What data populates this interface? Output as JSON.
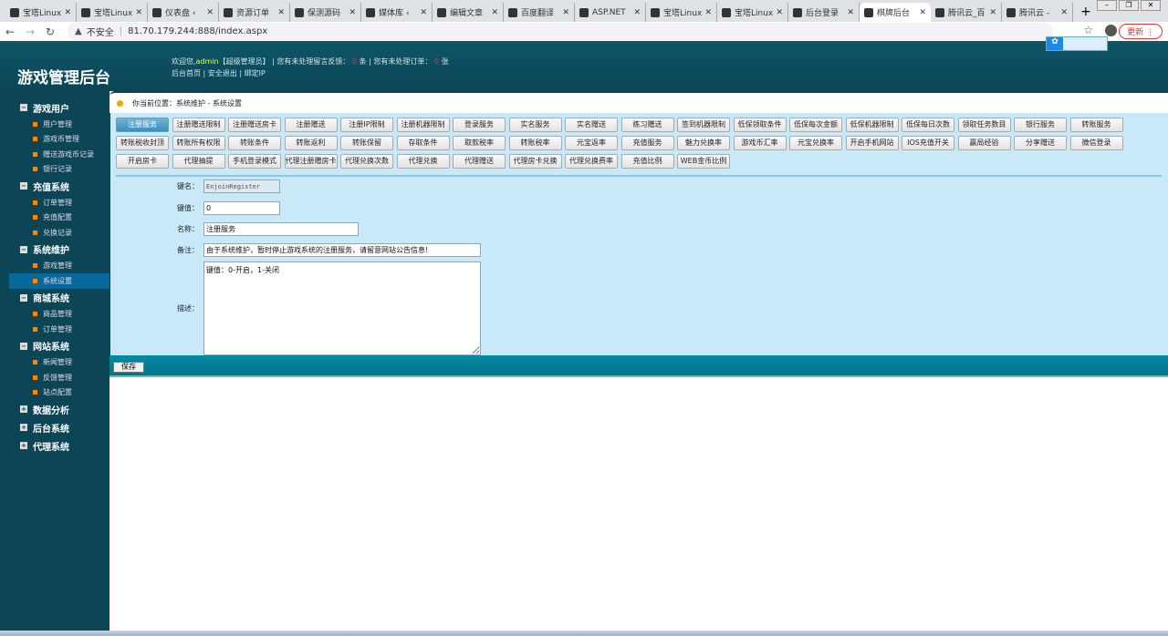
{
  "browser": {
    "tabs": [
      {
        "label": "宝塔Linux",
        "icon": "BT"
      },
      {
        "label": "宝塔Linux",
        "icon": "BT"
      },
      {
        "label": "仪表盘 ‹",
        "icon": "W"
      },
      {
        "label": "资源订单",
        "icon": "W"
      },
      {
        "label": "保测源码",
        "icon": "W"
      },
      {
        "label": "媒体库 ‹",
        "icon": "globe"
      },
      {
        "label": "编辑文章",
        "icon": "globe"
      },
      {
        "label": "百度翻译",
        "icon": "译"
      },
      {
        "label": "ASP.NET",
        "icon": "asp"
      },
      {
        "label": "宝塔Linux",
        "icon": "BT"
      },
      {
        "label": "宝塔Linux",
        "icon": "BT"
      },
      {
        "label": "后台登录",
        "icon": "globe"
      },
      {
        "label": "棋牌后台",
        "icon": "game",
        "active": true
      },
      {
        "label": "腾讯云_百",
        "icon": "paw"
      },
      {
        "label": "腾讯云 -",
        "icon": "cloud"
      }
    ],
    "insecure": "不安全",
    "url": "81.70.179.244:888/index.aspx",
    "update": "更新"
  },
  "header": {
    "title": "游戏管理后台",
    "welcome_prefix": "欢迎您,",
    "user": "admin",
    "role": "【超级管理员】",
    "feedback_prefix": "| 您有未处理留言反馈：",
    "feedback_count": "0",
    "feedback_unit": "条",
    "orders_prefix": "| 您有未处理订单：",
    "orders_count": "0",
    "orders_unit": "张",
    "links": [
      "后台首页",
      "安全退出",
      "绑定IP"
    ]
  },
  "sidebar": [
    {
      "label": "游戏用户",
      "expanded": true,
      "items": [
        "用户管理",
        "游戏币管理",
        "赠送游戏币记录",
        "银行记录"
      ]
    },
    {
      "label": "充值系统",
      "expanded": true,
      "items": [
        "订单管理",
        "充值配置",
        "兑换记录"
      ]
    },
    {
      "label": "系统维护",
      "expanded": true,
      "items": [
        "游戏管理",
        "系统设置"
      ],
      "selected": "系统设置"
    },
    {
      "label": "商城系统",
      "expanded": true,
      "items": [
        "商品管理",
        "订单管理"
      ]
    },
    {
      "label": "网站系统",
      "expanded": true,
      "items": [
        "新闻管理",
        "反馈管理",
        "站点配置"
      ]
    },
    {
      "label": "数据分析",
      "expanded": false,
      "items": []
    },
    {
      "label": "后台系统",
      "expanded": false,
      "items": []
    },
    {
      "label": "代理系统",
      "expanded": false,
      "items": []
    }
  ],
  "breadcrumb": "你当前位置：系统维护 - 系统设置",
  "setting_buttons": [
    [
      "注册服务",
      "注册赠送限制",
      "注册赠送房卡",
      "注册赠送",
      "注册IP限制",
      "注册机器限制",
      "登录服务",
      "实名服务",
      "实名赠送",
      "练习赠送",
      "签到机器限制",
      "低保领取条件",
      "低保每次金额",
      "低保机器限制",
      "低保每日次数",
      "领取任务数目",
      "银行服务",
      "转账服务"
    ],
    [
      "转账税收封顶",
      "转账所有权限",
      "转账条件",
      "转账返利",
      "转账保留",
      "存取条件",
      "取款税率",
      "转账税率",
      "元宝返率",
      "充值服务",
      "魅力兑换率",
      "游戏币汇率",
      "元宝兑换率",
      "开启手机网站",
      "IOS充值开关",
      "赢局经验",
      "分享赠送",
      "微信登录"
    ],
    [
      "开启房卡",
      "代理抽提",
      "手机登录模式",
      "代理注册赠房卡",
      "代理兑换次数",
      "代理兑换",
      "代理赠送",
      "代理房卡兑换",
      "代理兑换费率",
      "充值比例",
      "WEB金币比例"
    ]
  ],
  "active_button": "注册服务",
  "form": {
    "key_label": "键名：",
    "key_value": "EnjoinRegister",
    "val_label": "键值：",
    "val_value": "0",
    "name_label": "名称：",
    "name_value": "注册服务",
    "note_label": "备注：",
    "note_value": "由于系统维护，暂时停止游戏系统的注册服务，请留意网站公告信息!",
    "desc_label": "描述：",
    "desc_value": "键值：0-开启，1-关闭",
    "save": "保存"
  }
}
